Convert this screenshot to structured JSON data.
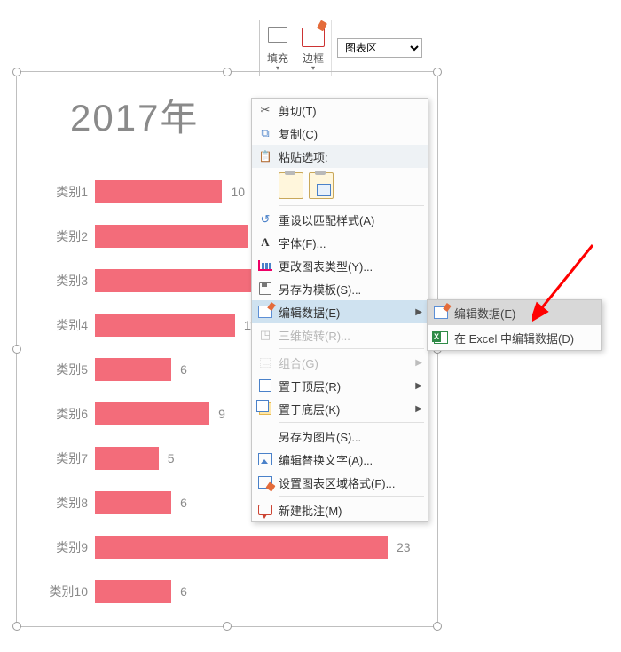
{
  "toolbar": {
    "fill_label": "填充",
    "outline_label": "边框",
    "area_select": "图表区"
  },
  "chart_title": "2017年",
  "chart_data": {
    "type": "bar",
    "orientation": "horizontal",
    "title": "2017年",
    "categories": [
      "类别1",
      "类别2",
      "类别3",
      "类别4",
      "类别5",
      "类别6",
      "类别7",
      "类别8",
      "类别9",
      "类别10"
    ],
    "values": [
      10,
      12,
      17,
      11,
      6,
      9,
      5,
      6,
      23,
      6
    ],
    "color": "#f36c7a"
  },
  "context_menu": {
    "cut": "剪切(T)",
    "copy": "复制(C)",
    "paste_header": "粘贴选项:",
    "reset_style": "重设以匹配样式(A)",
    "font": "字体(F)...",
    "change_type": "更改图表类型(Y)...",
    "save_template": "另存为模板(S)...",
    "edit_data": "编辑数据(E)",
    "rotate3d": "三维旋转(R)...",
    "group": "组合(G)",
    "bring_front": "置于顶层(R)",
    "send_back": "置于底层(K)",
    "save_as_pic": "另存为图片(S)...",
    "alt_text": "编辑替换文字(A)...",
    "format_area": "设置图表区域格式(F)...",
    "new_comment": "新建批注(M)"
  },
  "submenu": {
    "edit_data": "编辑数据(E)",
    "edit_in_excel": "在 Excel 中编辑数据(D)"
  }
}
